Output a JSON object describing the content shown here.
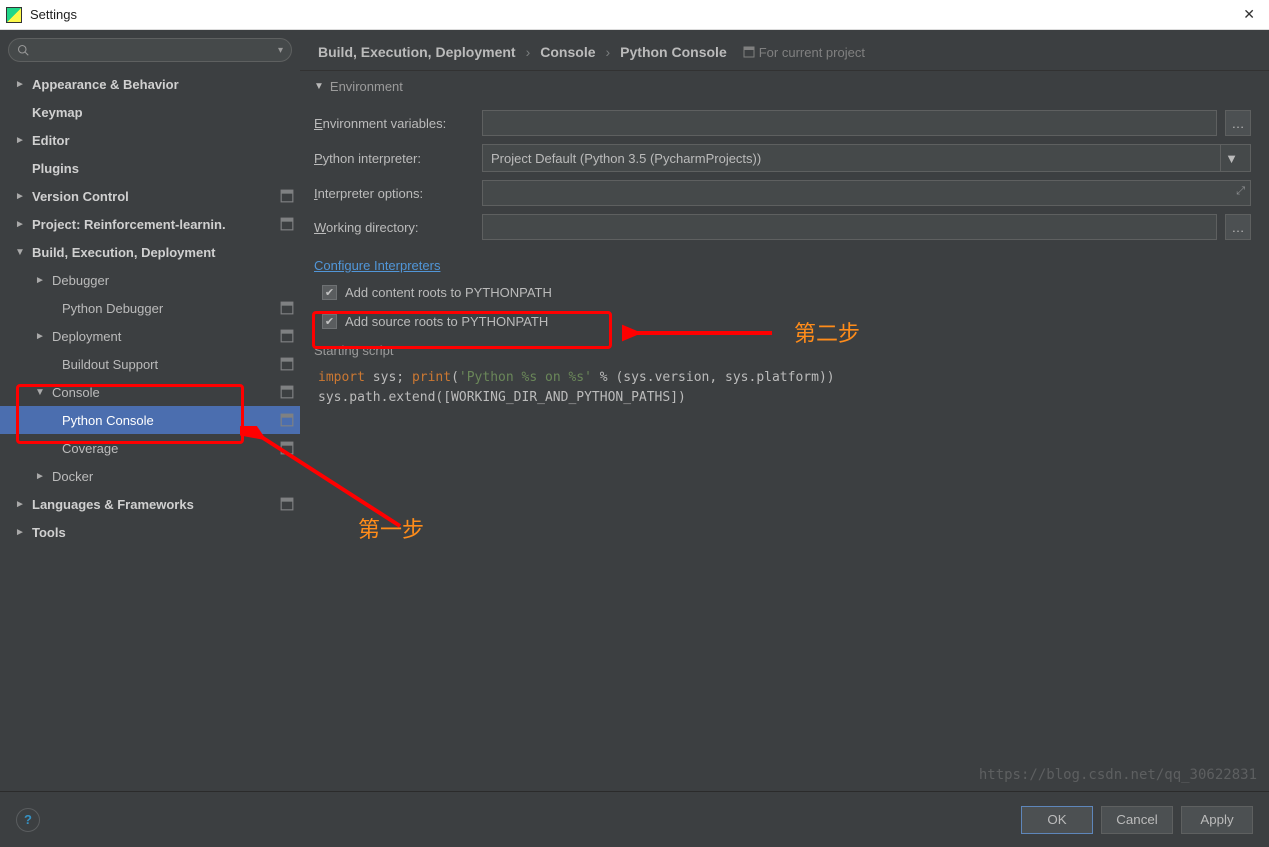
{
  "window": {
    "title": "Settings"
  },
  "sidebar": {
    "search_placeholder": "",
    "items": [
      {
        "label": "Appearance & Behavior",
        "bold": true,
        "arrow": "►",
        "indent": 0,
        "badge": false
      },
      {
        "label": "Keymap",
        "bold": true,
        "arrow": "",
        "indent": 0,
        "badge": false,
        "noarrow": true
      },
      {
        "label": "Editor",
        "bold": true,
        "arrow": "►",
        "indent": 0,
        "badge": false
      },
      {
        "label": "Plugins",
        "bold": true,
        "arrow": "",
        "indent": 0,
        "badge": false,
        "noarrow": true
      },
      {
        "label": "Version Control",
        "bold": true,
        "arrow": "►",
        "indent": 0,
        "badge": true
      },
      {
        "label": "Project: Reinforcement-learnin.",
        "bold": true,
        "arrow": "►",
        "indent": 0,
        "badge": true
      },
      {
        "label": "Build, Execution, Deployment",
        "bold": true,
        "arrow": "▼",
        "indent": 0,
        "badge": false
      },
      {
        "label": "Debugger",
        "bold": false,
        "arrow": "►",
        "indent": 1,
        "badge": false
      },
      {
        "label": "Python Debugger",
        "bold": false,
        "arrow": "",
        "indent": 2,
        "badge": true,
        "noarrow": true
      },
      {
        "label": "Deployment",
        "bold": false,
        "arrow": "►",
        "indent": 1,
        "badge": true
      },
      {
        "label": "Buildout Support",
        "bold": false,
        "arrow": "",
        "indent": 2,
        "badge": true,
        "noarrow": true
      },
      {
        "label": "Console",
        "bold": false,
        "arrow": "▼",
        "indent": 1,
        "badge": true
      },
      {
        "label": "Python Console",
        "bold": false,
        "arrow": "",
        "indent": 2,
        "badge": true,
        "noarrow": true,
        "selected": true
      },
      {
        "label": "Coverage",
        "bold": false,
        "arrow": "",
        "indent": 2,
        "badge": true,
        "noarrow": true
      },
      {
        "label": "Docker",
        "bold": false,
        "arrow": "►",
        "indent": 1,
        "badge": false
      },
      {
        "label": "Languages & Frameworks",
        "bold": true,
        "arrow": "►",
        "indent": 0,
        "badge": true
      },
      {
        "label": "Tools",
        "bold": true,
        "arrow": "►",
        "indent": 0,
        "badge": false
      }
    ]
  },
  "breadcrumb": {
    "a": "Build, Execution, Deployment",
    "b": "Console",
    "c": "Python Console",
    "proj": "For current project"
  },
  "env": {
    "section": "Environment",
    "env_vars_label": "Environment variables:",
    "env_u": "E",
    "interp_label": "Python interpreter:",
    "interp_u": "P",
    "interp_value": "Project Default (Python 3.5 (PycharmProjects))",
    "opts_label": "Interpreter options:",
    "opts_u": "I",
    "workdir_label": "Working directory:",
    "workdir_u": "W",
    "config_link": "Configure Interpreters",
    "chk1": "Add content roots to PYTHONPATH",
    "chk2": "Add source roots to PYTHONPATH"
  },
  "script": {
    "label": "Starting script",
    "line1_kw": "import",
    "line1_a": " sys; ",
    "line1_fn": "print",
    "line1_b": "(",
    "line1_str": "'Python %s on %s'",
    "line1_c": " % (sys.version, sys.platform))",
    "line2": "sys.path.extend([WORKING_DIR_AND_PYTHON_PATHS])"
  },
  "footer": {
    "ok": "OK",
    "cancel": "Cancel",
    "apply": "Apply"
  },
  "annotations": {
    "step1": "第一步",
    "step2": "第二步"
  },
  "watermark": "https://blog.csdn.net/qq_30622831"
}
